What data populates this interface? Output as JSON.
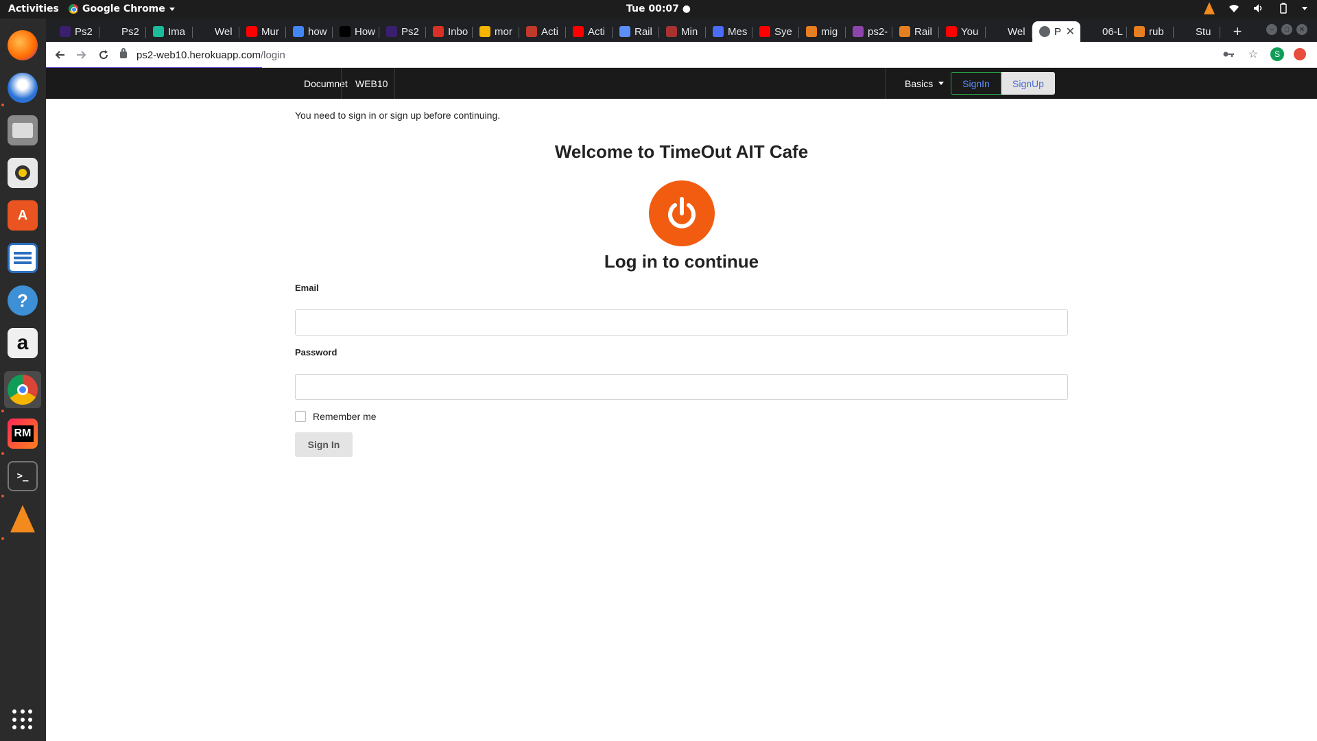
{
  "os": {
    "activities": "Activities",
    "app_name": "Google Chrome",
    "clock": "Tue 00:07 ●"
  },
  "dock": {
    "items": [
      "firefox-icon",
      "thunderbird-icon",
      "files-icon",
      "rhythmbox-icon",
      "software-icon",
      "writer-icon",
      "help-icon",
      "amazon-icon",
      "chrome-icon",
      "rubymine-icon",
      "terminal-icon",
      "vlc-icon"
    ],
    "rubymine_label": "RM",
    "amazon_label": "a",
    "help_label": "?",
    "terminal_label": ">_"
  },
  "tabs": [
    {
      "label": "Ps2",
      "color": "#3a1f6e"
    },
    {
      "label": "Ps2",
      "color": "#202124"
    },
    {
      "label": "Ima",
      "color": "#1abc9c"
    },
    {
      "label": "Wel",
      "color": "#202124"
    },
    {
      "label": "Mur",
      "color": "#ff0000"
    },
    {
      "label": "how",
      "color": "#4285f4"
    },
    {
      "label": "How",
      "color": "#000000"
    },
    {
      "label": "Ps2",
      "color": "#3a1f6e"
    },
    {
      "label": "Inbo",
      "color": "#d93025"
    },
    {
      "label": "mor",
      "color": "#f4b400"
    },
    {
      "label": "Acti",
      "color": "#c0392b"
    },
    {
      "label": "Acti",
      "color": "#ff0000"
    },
    {
      "label": "Rail",
      "color": "#5b8ff9"
    },
    {
      "label": "Min",
      "color": "#a83232"
    },
    {
      "label": "Mes",
      "color": "#4a6cf7"
    },
    {
      "label": "Sye",
      "color": "#ff0000"
    },
    {
      "label": "mig",
      "color": "#e67e22"
    },
    {
      "label": "ps2-",
      "color": "#8e44ad"
    },
    {
      "label": "Rail",
      "color": "#e67e22"
    },
    {
      "label": "You",
      "color": "#ff0000"
    },
    {
      "label": "Wel",
      "color": "#202124"
    },
    {
      "label": "P",
      "color": "#5f6368",
      "active": true
    },
    {
      "label": "06-L",
      "color": "#202124"
    },
    {
      "label": "rub",
      "color": "#e67e22"
    },
    {
      "label": "Stu",
      "color": "#202124"
    }
  ],
  "browser": {
    "url_host": "ps2-web10.herokuapp.com",
    "url_path": "/login",
    "profile_initial": "S",
    "new_tab": "+",
    "close_tab": "✕",
    "page_load_progress": 0.17
  },
  "navbar": {
    "links": [
      "Documnet",
      "WEB10"
    ],
    "dropdown_label": "Basics",
    "signin_label": "SignIn",
    "signup_label": "SignUp"
  },
  "page": {
    "flash": "You need to sign in or sign up before continuing.",
    "welcome": "Welcome to TimeOut AIT Cafe",
    "login_title": "Log in to continue",
    "email_label": "Email",
    "email_value": "",
    "password_label": "Password",
    "password_value": "",
    "remember_label": "Remember me",
    "submit_label": "Sign In",
    "accent_color": "#f25c11"
  }
}
